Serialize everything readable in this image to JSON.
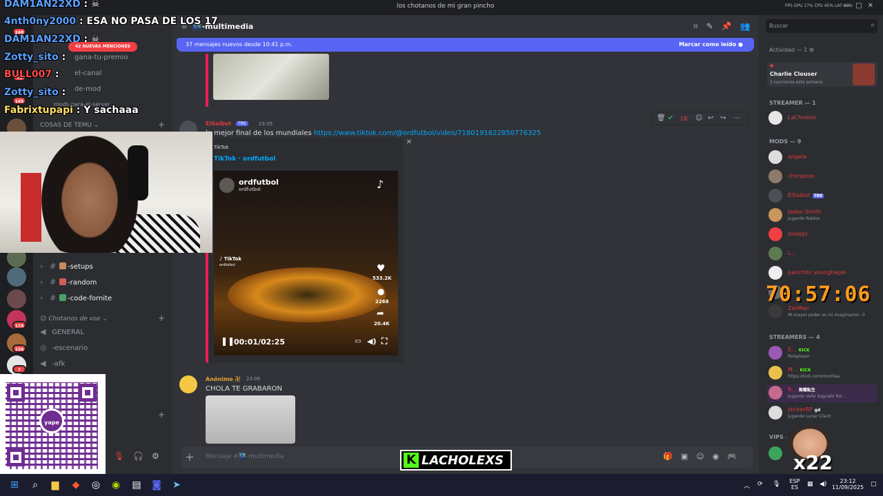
{
  "window": {
    "title": "los chotanos de mi gran pincho",
    "stats": "FPS GPU 17% CPU 45% LAT 80%"
  },
  "server_badges": [
    "248",
    "73",
    "145",
    "174",
    "156",
    "7"
  ],
  "sidebar": {
    "channels_top": [
      "gana-tu-premio",
      "el-canal",
      "de-mod",
      "mods-para-el-server"
    ],
    "category_top": "COSAS DE TEMU",
    "channels": [
      "-setups",
      "-random",
      "-code-fornite"
    ],
    "voice_category": "Chotanos de voz",
    "voice_channels": [
      "GENERAL",
      "-escenario",
      "-afk"
    ]
  },
  "chat": {
    "channel": "-multimedia",
    "new_messages": "37 mensajes nuevos desde 10:41 p.m.",
    "mark_read": "Marcar como leído",
    "messages": [
      {
        "author": "ElSaibot",
        "tag": "TRE",
        "time": "23:05",
        "text": "lo mejor final de los mundiales",
        "link": "https://www.tiktok.com/@ordfutbol/video/7180191622850776325",
        "embed": {
          "provider": "TikTok",
          "author": "TikTok · ordfutbol",
          "video_user": "ordfutbol",
          "video_handle": "ordfutbol",
          "likes": "533.2K",
          "comments": "2268",
          "shares": "20.4K",
          "time": "00:01/02:25",
          "watermark": "TikTok",
          "watermark_handle": "ordfutbol"
        }
      },
      {
        "author": "Anónimo 卍",
        "time": "23:06",
        "text": "CHOLA TE GRABARON"
      }
    ],
    "hover_count": "18",
    "composer_placeholder": "Mensaje #🌃-multimedia"
  },
  "members": {
    "search_placeholder": "Buscar",
    "activity_header": "Actividad — 1",
    "activity": {
      "name": "Charlie Clouser",
      "detail": "3 canciones esta semana"
    },
    "streamer_header": "STREAMER — 1",
    "streamer_name": "LaCholexs",
    "mods_header": "MODS — 9",
    "mods": [
      {
        "name": "angela",
        "status": ""
      },
      {
        "name": "chimpoxo",
        "status": ""
      },
      {
        "name": "ElSaibot",
        "status": "",
        "tag": "TRE"
      },
      {
        "name": "Jaden Smith",
        "status": "Jugando Roblox"
      },
      {
        "name": "Joseppi",
        "status": ""
      },
      {
        "name": "L...",
        "status": ""
      },
      {
        "name": "panchito younghagel",
        "status": ""
      },
      {
        "name": "...",
        "status": ""
      },
      {
        "name": "ZerMan",
        "status": "Mi mayor poder es mi imaginacion :3"
      }
    ],
    "streamers_header": "STREAMERS — 4",
    "streamers": [
      {
        "name": "E...",
        "status": "Roleplayer",
        "tag": "KICK"
      },
      {
        "name": "M...",
        "status": "https://kick.com/mozillaa",
        "tag": "KICK"
      },
      {
        "name": "R...",
        "status": "Jugando Valle Sagrado Rol...",
        "tag": "無職転生"
      },
      {
        "name": "strikerRP",
        "status": "Jugando Lunar Client",
        "tag": "gd"
      }
    ],
    "vips_header": "VIPS —"
  },
  "overlay": {
    "chat": [
      {
        "user": "DAM1AN22XD",
        "text": ""
      },
      {
        "user": "4nth0ny2000",
        "text": "ESA NO PASA DE LOS 17"
      },
      {
        "user": "DAM1AN22XD",
        "text": ""
      },
      {
        "user": "Zotty_sito",
        "text": ""
      },
      {
        "user": "BULL007",
        "text": ""
      },
      {
        "user": "Zotty_sito",
        "text": ""
      },
      {
        "user": "Fabrixtupapi",
        "text": "Y sachaaa"
      }
    ],
    "mentions": "42 NUEVAS MENCIONES",
    "timer": "70:57:06",
    "qr_logo": "yape",
    "kick_brand": "LACHOLEXS",
    "multiplier": "x22"
  },
  "taskbar": {
    "lang": "ESP",
    "lang2": "ES",
    "time": "23:12",
    "date": "11/09/2025"
  }
}
